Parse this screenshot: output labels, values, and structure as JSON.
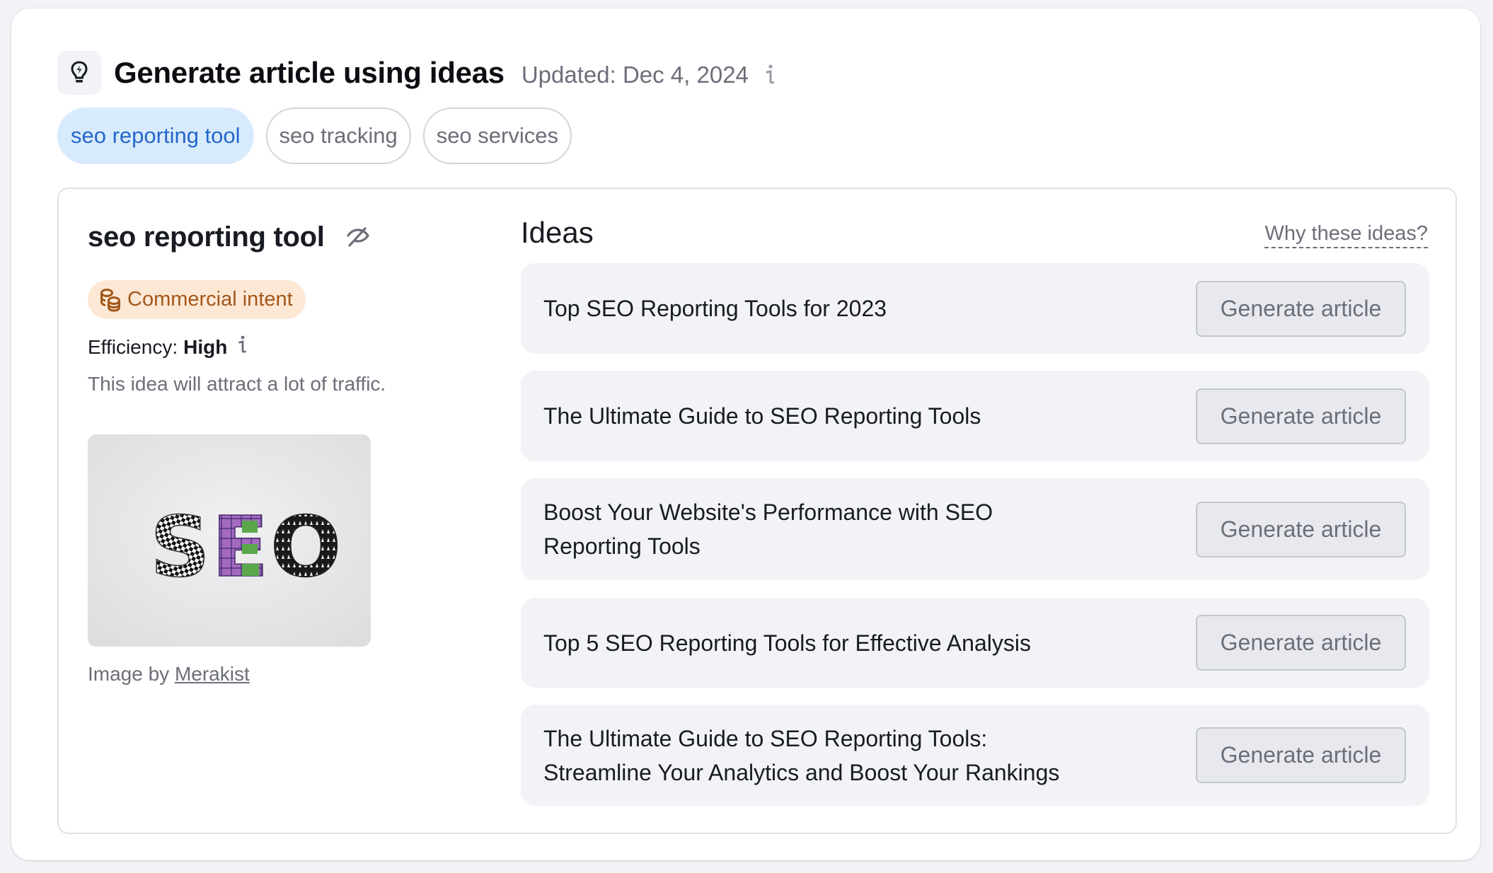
{
  "header": {
    "icon": "lightbulb-bolt-icon",
    "title": "Generate article using ideas",
    "updated": "Updated: Dec 4, 2024",
    "info_icon": "info-icon"
  },
  "keyword_tabs": [
    {
      "label": "seo reporting tool",
      "active": true
    },
    {
      "label": "seo tracking",
      "active": false
    },
    {
      "label": "seo services",
      "active": false
    }
  ],
  "keyword_panel": {
    "title": "seo reporting tool",
    "hide_icon": "eye-slash-icon",
    "intent": {
      "icon": "coins-icon",
      "label": "Commercial intent",
      "bg": "#fde8d5",
      "color": "#a2571a"
    },
    "efficiency_label": "Efficiency:",
    "efficiency_value": "High",
    "efficiency_description": "This idea will attract a lot of traffic.",
    "image_alt": "SEO letters",
    "image_credit_prefix": "Image by",
    "image_credit_author": "Merakist"
  },
  "ideas": {
    "heading": "Ideas",
    "why_link": "Why these ideas?",
    "items": [
      {
        "title": "Top SEO Reporting Tools for 2023",
        "button": "Generate article"
      },
      {
        "title": "The Ultimate Guide to SEO Reporting Tools",
        "button": "Generate article"
      },
      {
        "title": "Boost Your Website's Performance with SEO Reporting Tools",
        "button": "Generate article"
      },
      {
        "title": "Top 5 SEO Reporting Tools for Effective Analysis",
        "button": "Generate article"
      },
      {
        "title": "The Ultimate Guide to SEO Reporting Tools: Streamline Your Analytics and Boost Your Rankings",
        "button": "Generate article"
      }
    ]
  },
  "colors": {
    "accent": "#2567c9",
    "active_tab_bg": "#d8ebfd",
    "muted_text": "#6c6e79",
    "row_bg": "#f2f3f7"
  }
}
